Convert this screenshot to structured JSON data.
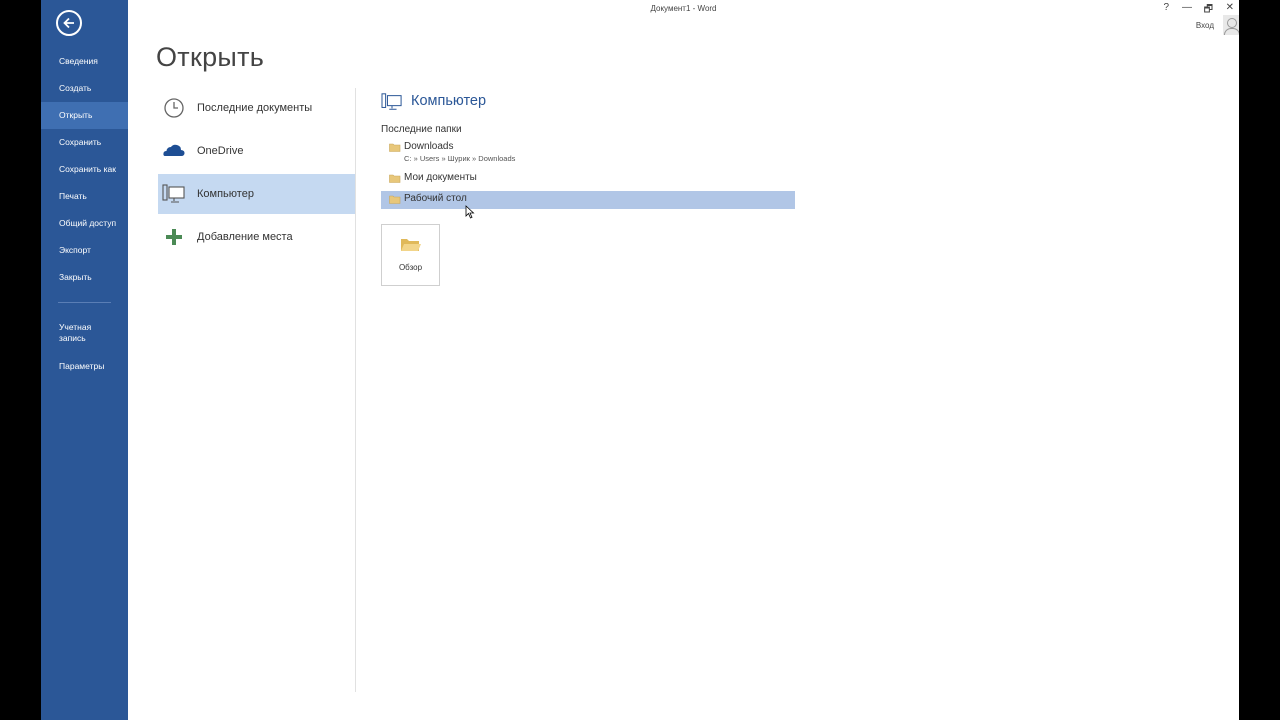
{
  "window": {
    "title": "Документ1 - Word",
    "help": "?",
    "minimize": "—",
    "restore": "🗗",
    "close": "✕",
    "sign_in": "Вход"
  },
  "sidebar": {
    "items": [
      {
        "label": "Сведения"
      },
      {
        "label": "Создать"
      },
      {
        "label": "Открыть"
      },
      {
        "label": "Сохранить"
      },
      {
        "label": "Сохранить как"
      },
      {
        "label": "Печать"
      },
      {
        "label": "Общий доступ"
      },
      {
        "label": "Экспорт"
      },
      {
        "label": "Закрыть"
      }
    ],
    "account": "Учетная запись",
    "options": "Параметры"
  },
  "page": {
    "title": "Открыть"
  },
  "places": [
    {
      "label": "Последние документы",
      "icon": "clock-icon"
    },
    {
      "label": "OneDrive",
      "icon": "cloud-icon"
    },
    {
      "label": "Компьютер",
      "icon": "computer-icon"
    },
    {
      "label": "Добавление места",
      "icon": "plus-icon"
    }
  ],
  "detail": {
    "title": "Компьютер",
    "recent_folders_label": "Последние папки",
    "folders": [
      {
        "name": "Downloads",
        "path": "C: » Users » Шурик » Downloads"
      },
      {
        "name": "Мои документы"
      },
      {
        "name": "Рабочий стол"
      }
    ],
    "browse_label": "Обзор"
  },
  "colors": {
    "accent": "#2b5797",
    "nav_active": "#3f6fb2",
    "place_active": "#c5d9f1",
    "folder_selected": "#b1c6e6"
  }
}
